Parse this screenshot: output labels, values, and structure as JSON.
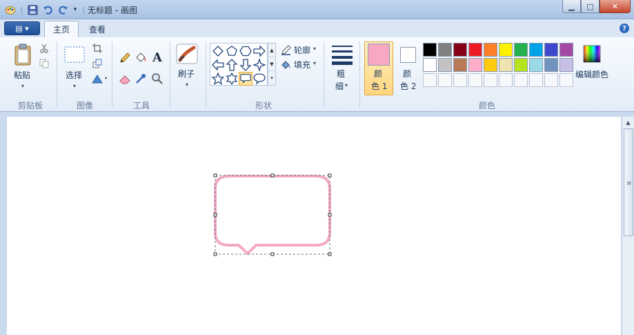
{
  "window": {
    "title": "无标题 - 画图",
    "minimize": "▁",
    "maximize": "□",
    "close": "✕"
  },
  "tabs": [
    "主页",
    "查看"
  ],
  "help": "?",
  "ribbon": {
    "clipboard": {
      "paste": "粘贴",
      "group": "剪贴板"
    },
    "image": {
      "select": "选择",
      "group": "图像"
    },
    "tools": {
      "group": "工具",
      "text_tool": "A"
    },
    "brushes": {
      "label": "刷子"
    },
    "shapes": {
      "outline": "轮廓",
      "fill": "填充",
      "group": "形状"
    },
    "size": {
      "line1": "粗",
      "line2": "细"
    },
    "colors": {
      "color1_line1": "颜",
      "color1_line2": "色 1",
      "color2_line1": "颜",
      "color2_line2": "色 2",
      "edit": "编辑颜色",
      "group": "颜色",
      "color1": "#f9a8c4",
      "color2": "#ffffff",
      "palette_row1": [
        "#000000",
        "#7f7f7f",
        "#880015",
        "#ed1c24",
        "#ff7f27",
        "#fff200",
        "#22b14c",
        "#00a2e8",
        "#3f48cc",
        "#a349a4"
      ],
      "palette_row2": [
        "#ffffff",
        "#c3c3c3",
        "#b97a57",
        "#ffaec9",
        "#ffc90e",
        "#efe4b0",
        "#b5e61d",
        "#99d9ea",
        "#7092be",
        "#c8bfe7"
      ]
    }
  },
  "canvas": {
    "shape": "rounded-rectangle-callout",
    "outline_color": "#f3aac4"
  }
}
